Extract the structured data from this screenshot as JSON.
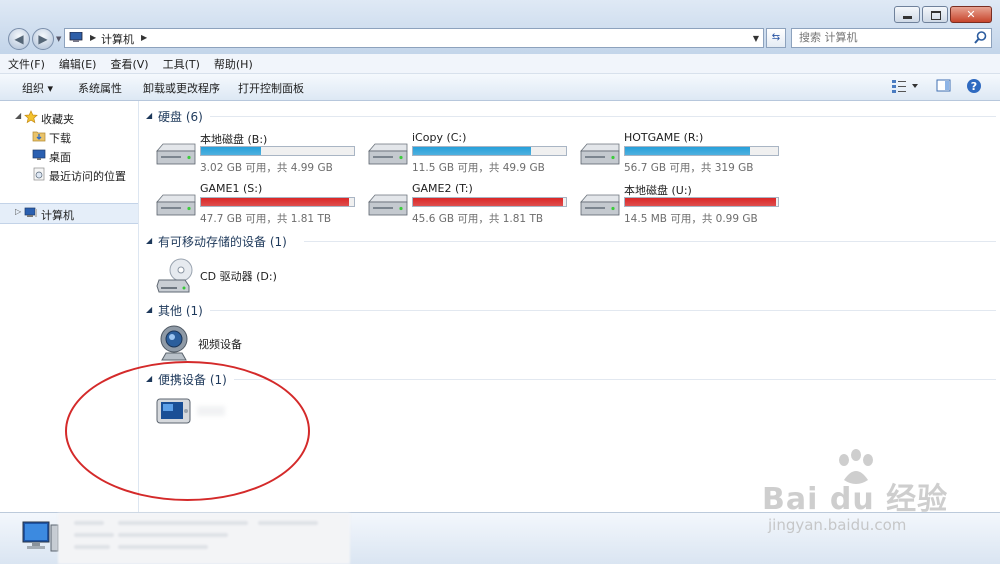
{
  "window": {
    "controls": [
      "minimize",
      "maximize",
      "close"
    ]
  },
  "address": {
    "segments": [
      "计算机"
    ]
  },
  "search": {
    "placeholder": "搜索 计算机"
  },
  "menu": [
    "文件(F)",
    "编辑(E)",
    "查看(V)",
    "工具(T)",
    "帮助(H)"
  ],
  "toolbar": {
    "organize": "组织 ▾",
    "system_properties": "系统属性",
    "uninstall": "卸载或更改程序",
    "control_panel": "打开控制面板"
  },
  "nav": {
    "favorites": "收藏夹",
    "downloads": "下载",
    "desktop": "桌面",
    "recent": "最近访问的位置",
    "computer": "计算机"
  },
  "groups": {
    "hdd": "硬盘 (6)",
    "removable": "有可移动存储的设备 (1)",
    "other": "其他 (1)",
    "portable": "便携设备 (1)"
  },
  "drives": [
    {
      "name": "本地磁盘 (B:)",
      "info": "3.02 GB 可用，共 4.99 GB",
      "used_fraction": 0.39,
      "status_color": "#26a0da"
    },
    {
      "name": "iCopy (C:)",
      "info": "11.5 GB 可用，共 49.9 GB",
      "used_fraction": 0.77,
      "status_color": "#26a0da"
    },
    {
      "name": "HOTGAME (R:)",
      "info": "56.7 GB 可用，共 319 GB",
      "used_fraction": 0.82,
      "status_color": "#26a0da"
    },
    {
      "name": "GAME1 (S:)",
      "info": "47.7 GB 可用，共 1.81 TB",
      "used_fraction": 0.97,
      "status_color": "#da2626"
    },
    {
      "name": "GAME2 (T:)",
      "info": "45.6 GB 可用，共 1.81 TB",
      "used_fraction": 0.98,
      "status_color": "#da2626"
    },
    {
      "name": "本地磁盘 (U:)",
      "info": "14.5 MB 可用，共 0.99 GB",
      "used_fraction": 0.99,
      "status_color": "#da2626"
    }
  ],
  "cd_drive": {
    "name": "CD 驱动器 (D:)"
  },
  "video_device": {
    "name": "视频设备"
  },
  "watermark": {
    "main": "Bai du 经验",
    "sub": "jingyan.baidu.com"
  }
}
